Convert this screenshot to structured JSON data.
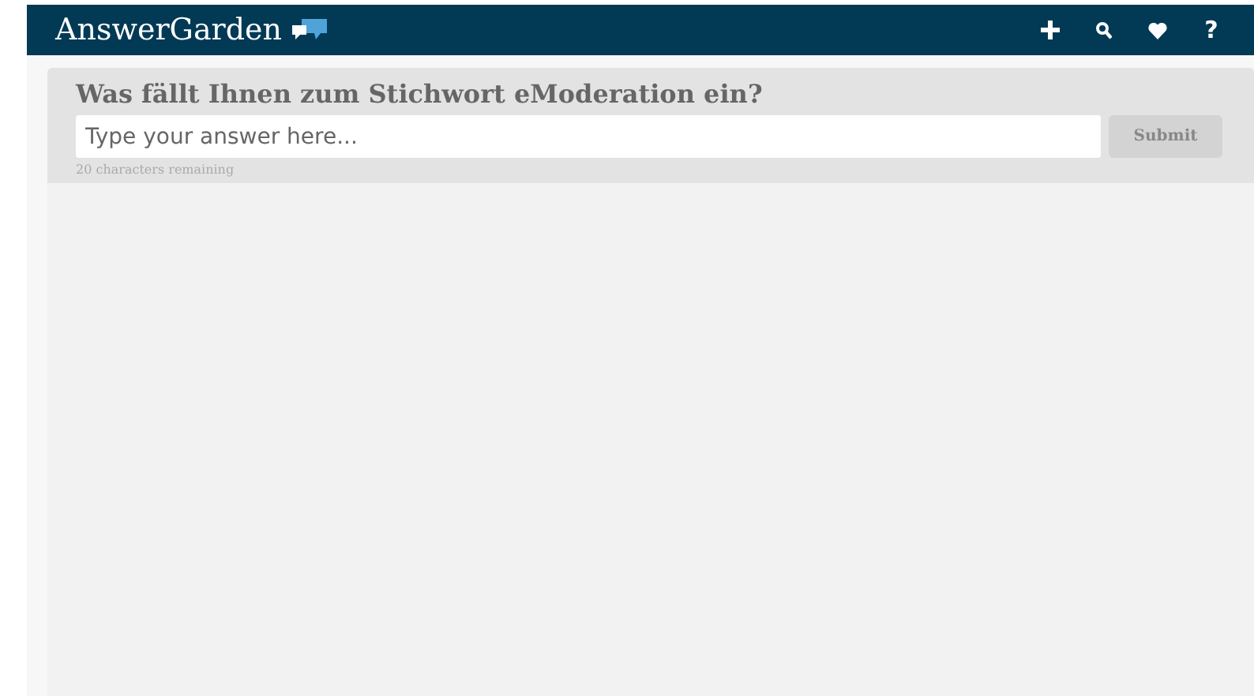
{
  "header": {
    "logo": "AnswerGarden",
    "help": "?"
  },
  "question": {
    "title": "Was fällt Ihnen zum Stichwort eModeration ein?",
    "placeholder": "Type your answer here...",
    "submit": "Submit",
    "counter": "20 characters remaining"
  }
}
